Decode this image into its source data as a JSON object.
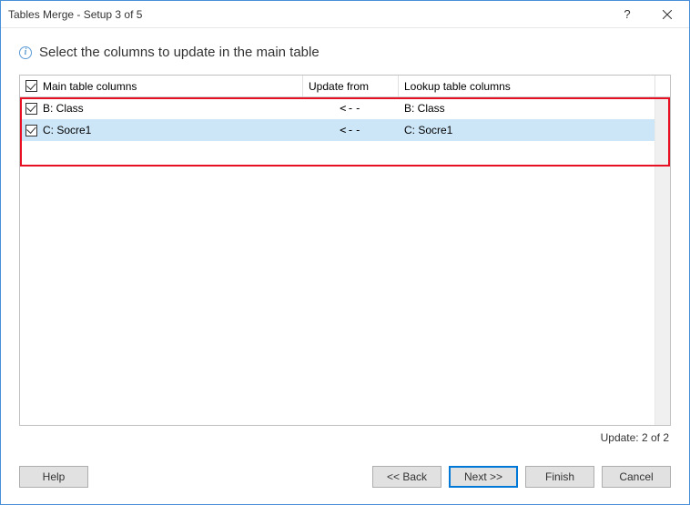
{
  "titlebar": {
    "title": "Tables Merge - Setup 3 of 5"
  },
  "instruction": "Select the columns to update in the main table",
  "table": {
    "headers": {
      "main": "Main table columns",
      "update": "Update from",
      "lookup": "Lookup table columns"
    },
    "rows": [
      {
        "main": "B: Class",
        "arrow": "<--",
        "lookup": "B: Class",
        "checked": true,
        "selected": false
      },
      {
        "main": "C: Socre1",
        "arrow": "<--",
        "lookup": "C: Socre1",
        "checked": true,
        "selected": true
      }
    ]
  },
  "status": "Update: 2 of 2",
  "buttons": {
    "help": "Help",
    "back": "<< Back",
    "next": "Next >>",
    "finish": "Finish",
    "cancel": "Cancel"
  }
}
